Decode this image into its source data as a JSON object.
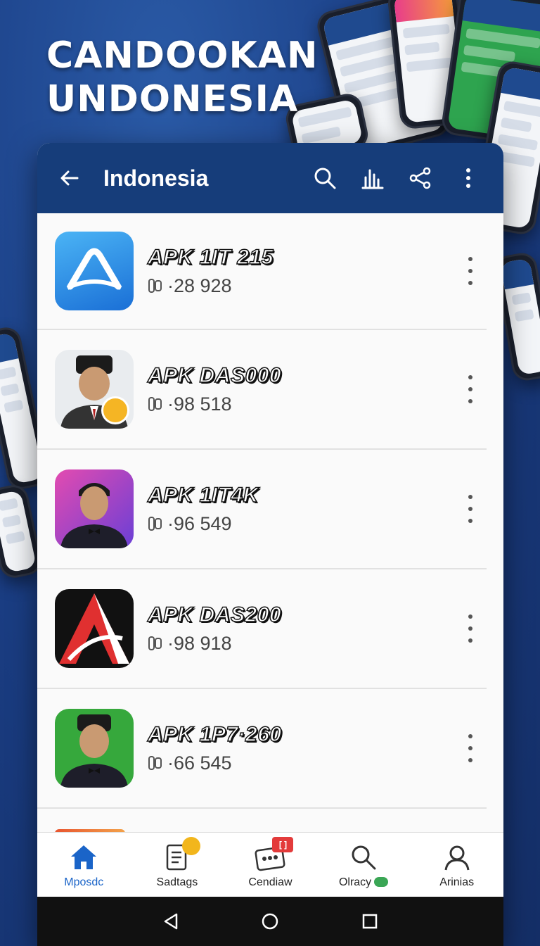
{
  "headline": {
    "line1": "CANDOOKAN",
    "line2": "UNDONESIA"
  },
  "appbar": {
    "title": "Indonesia"
  },
  "items": [
    {
      "name": "APK 1IT 215",
      "count": "·28 928"
    },
    {
      "name": "APK DAS000",
      "count": "·98 518"
    },
    {
      "name": "APK 1IT4K",
      "count": "·96 549"
    },
    {
      "name": "APK DAS200",
      "count": "·98 918"
    },
    {
      "name": "APK 1P7·260",
      "count": "·66 545"
    }
  ],
  "nav": [
    {
      "label": "Mposdc"
    },
    {
      "label": "Sadtags"
    },
    {
      "label": "Cendiaw",
      "badge": "[ ]"
    },
    {
      "label": "Olracy"
    },
    {
      "label": "Arinias"
    }
  ],
  "colors": {
    "appbar": "#163d7a",
    "accent": "#1a64c8",
    "background": "#1b3f86"
  }
}
